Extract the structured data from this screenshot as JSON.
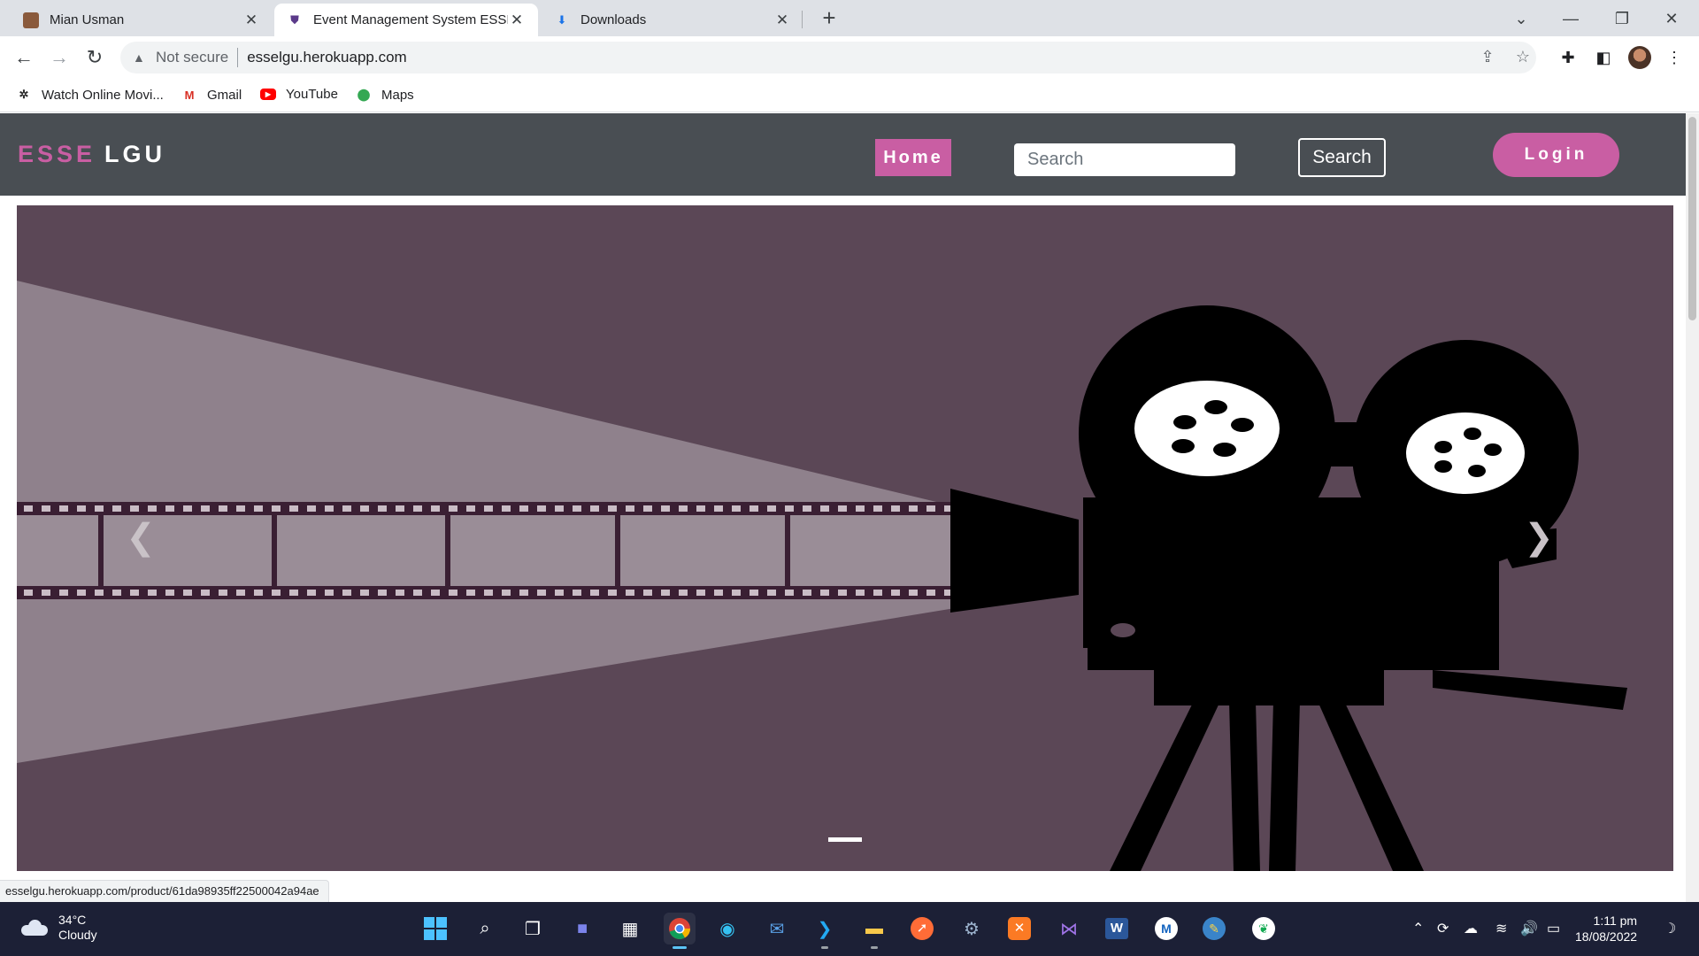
{
  "browser": {
    "tabs": [
      {
        "title": "Mian Usman",
        "favicon": "profile-avatar-icon",
        "active": false
      },
      {
        "title": "Event Management System ESSE",
        "favicon": "shield-favicon-icon",
        "active": true
      },
      {
        "title": "Downloads",
        "favicon": "download-icon",
        "active": false
      }
    ],
    "security_label": "Not secure",
    "url": "esselgu.herokuapp.com",
    "bookmarks": [
      {
        "label": "Watch Online Movi...",
        "icon": "film-reel-icon"
      },
      {
        "label": "Gmail",
        "icon": "gmail-icon"
      },
      {
        "label": "YouTube",
        "icon": "youtube-icon"
      },
      {
        "label": "Maps",
        "icon": "maps-pin-icon"
      }
    ],
    "status_url": "esselgu.herokuapp.com/product/61da98935ff22500042a94ae"
  },
  "site": {
    "brand_part1": "ESSE",
    "brand_part2": "LGU",
    "nav": {
      "home_label": "Home",
      "search_placeholder": "Search",
      "search_button": "Search",
      "login_label": "Login"
    },
    "carousel": {
      "prev_icon": "chevron-left-icon",
      "next_icon": "chevron-right-icon",
      "active_slide": 1,
      "slide_count": 1,
      "colors": {
        "background": "#5b4756",
        "beam": "#8f818c",
        "camera": "#000000"
      }
    }
  },
  "colors": {
    "accent": "#c95ea3",
    "navbar": "#494e53"
  },
  "taskbar": {
    "weather_temp": "34°C",
    "weather_desc": "Cloudy",
    "time": "1:11 pm",
    "date": "18/08/2022",
    "apps": [
      "windows-start-icon",
      "search-icon",
      "task-view-icon",
      "chat-icon",
      "store-icon",
      "chrome-icon",
      "edge-icon",
      "mail-icon",
      "vscode-icon",
      "file-explorer-icon",
      "postman-icon",
      "settings-icon",
      "xampp-icon",
      "visual-studio-icon",
      "word-icon",
      "app-icon",
      "python-icon",
      "mongodb-icon"
    ]
  }
}
